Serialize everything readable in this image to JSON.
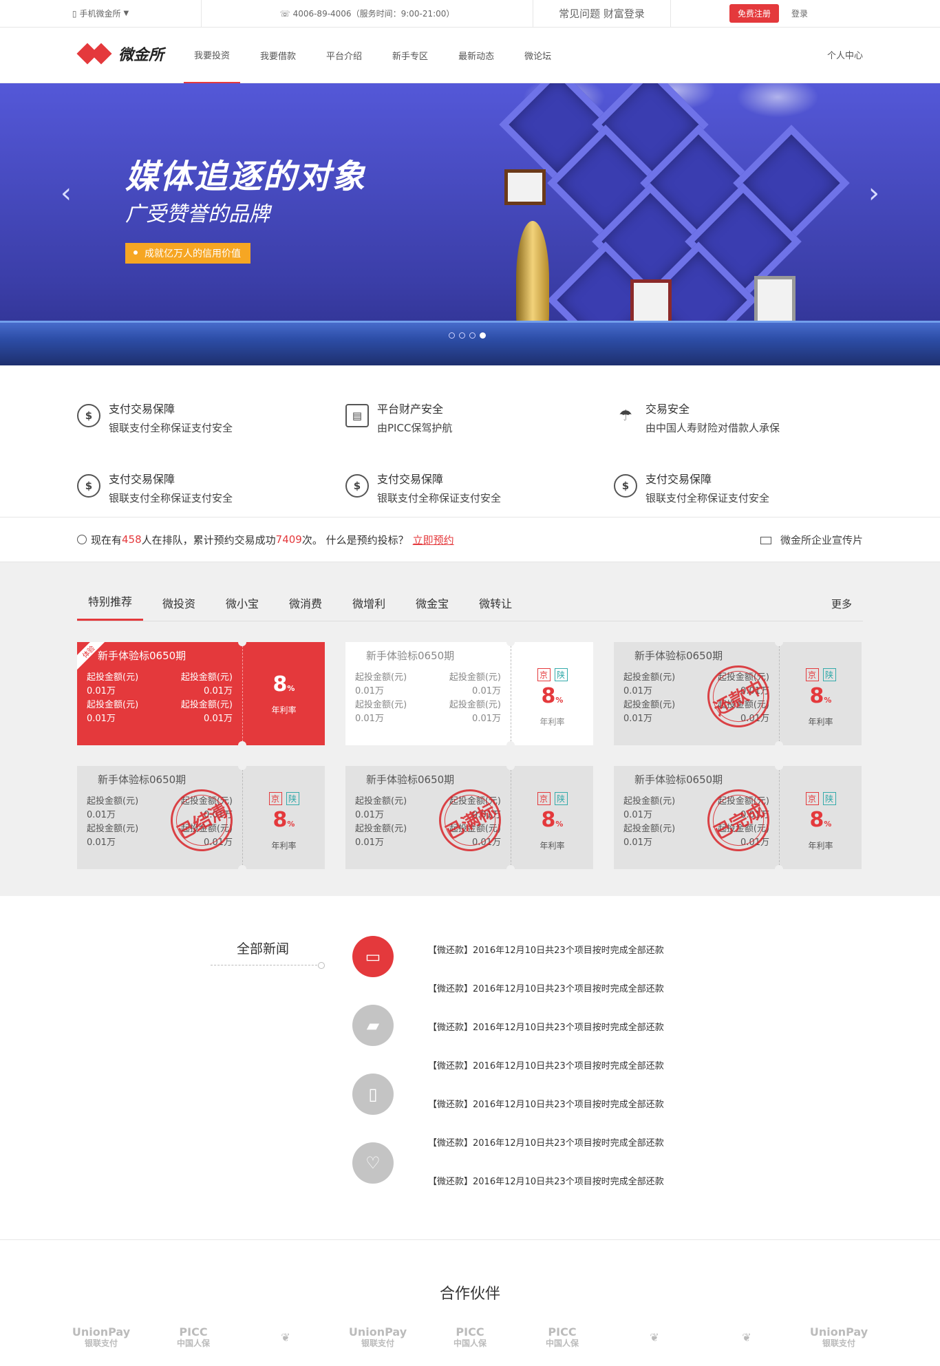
{
  "topbar": {
    "mobile": "手机微金所",
    "phone": "4006-89-4006（服务时间：9:00-21:00）",
    "faq": "常见问题 财富登录",
    "register": "免费注册",
    "login": "登录"
  },
  "nav": {
    "logo": "微金所",
    "items": [
      "我要投资",
      "我要借款",
      "平台介绍",
      "新手专区",
      "最新动态",
      "微论坛"
    ],
    "personal": "个人中心"
  },
  "banner": {
    "title": "媒体追逐的对象",
    "subtitle": "广受赞誉的品牌",
    "button": "成就亿万人的信用价值",
    "dots": 4,
    "active_dot": 4
  },
  "features": [
    {
      "icon": "dollar-shield-icon",
      "title": "支付交易保障",
      "desc": "银联支付全称保证支付安全"
    },
    {
      "icon": "register-icon",
      "title": "平台财产安全",
      "desc": "由PICC保驾护航"
    },
    {
      "icon": "umbrella-icon",
      "title": "交易安全",
      "desc": "由中国人寿财险对借款人承保"
    },
    {
      "icon": "dollar-shield-icon",
      "title": "支付交易保障",
      "desc": "银联支付全称保证支付安全"
    },
    {
      "icon": "dollar-shield-icon",
      "title": "支付交易保障",
      "desc": "银联支付全称保证支付安全"
    },
    {
      "icon": "dollar-shield-icon",
      "title": "支付交易保障",
      "desc": "银联支付全称保证支付安全"
    }
  ],
  "strip": {
    "t1": "现在有",
    "queue": "458",
    "t2": "人在排队，累计预约交易成功",
    "count": "7409",
    "t3": "次。 什么是预约投标？",
    "link": "立即预约",
    "video": "微金所企业宣传片"
  },
  "products": {
    "tabs": [
      "特别推荐",
      "微投资",
      "微小宝",
      "微消费",
      "微增利",
      "微金宝",
      "微转让"
    ],
    "more": "更多",
    "cards": [
      {
        "style": "red",
        "corner": "体验",
        "title": "新手体验标0650期",
        "k1": "起投金额(元)",
        "v1": "0.01万",
        "k2": "起投金额(元)",
        "v2": "0.01万",
        "rate": "8",
        "rate_unit": "%",
        "rate_label": "年利率",
        "badges": [],
        "stamp": ""
      },
      {
        "style": "white",
        "corner": "",
        "title": "新手体验标0650期",
        "k1": "起投金额(元)",
        "v1": "0.01万",
        "k2": "起投金额(元)",
        "v2": "0.01万",
        "rate": "8",
        "rate_unit": "%",
        "rate_label": "年利率",
        "badges": [
          "京",
          "陕"
        ],
        "stamp": ""
      },
      {
        "style": "grey",
        "corner": "",
        "title": "新手体验标0650期",
        "k1": "起投金额(元)",
        "v1": "0.01万",
        "k2": "起投金额(元)",
        "v2": "0.01万",
        "rate": "8",
        "rate_unit": "%",
        "rate_label": "年利率",
        "badges": [
          "京",
          "陕"
        ],
        "stamp": "还款中"
      },
      {
        "style": "grey",
        "corner": "",
        "title": "新手体验标0650期",
        "k1": "起投金额(元)",
        "v1": "0.01万",
        "k2": "起投金额(元)",
        "v2": "0.01万",
        "rate": "8",
        "rate_unit": "%",
        "rate_label": "年利率",
        "badges": [
          "京",
          "陕"
        ],
        "stamp": "已结清"
      },
      {
        "style": "grey",
        "corner": "",
        "title": "新手体验标0650期",
        "k1": "起投金额(元)",
        "v1": "0.01万",
        "k2": "起投金额(元)",
        "v2": "0.01万",
        "rate": "8",
        "rate_unit": "%",
        "rate_label": "年利率",
        "badges": [
          "京",
          "陕"
        ],
        "stamp": "已满标"
      },
      {
        "style": "grey",
        "corner": "",
        "title": "新手体验标0650期",
        "k1": "起投金额(元)",
        "v1": "0.01万",
        "k2": "起投金额(元)",
        "v2": "0.01万",
        "rate": "8",
        "rate_unit": "%",
        "rate_label": "年利率",
        "badges": [
          "京",
          "陕"
        ],
        "stamp": "已完成"
      }
    ]
  },
  "news": {
    "heading": "全部新闻",
    "icons": [
      "inbox-icon",
      "folder-icon",
      "phone-icon",
      "heart-icon"
    ],
    "items": [
      "【微还款】2016年12月10日共23个项目按时完成全部还款",
      "【微还款】2016年12月10日共23个项目按时完成全部还款",
      "【微还款】2016年12月10日共23个项目按时完成全部还款",
      "【微还款】2016年12月10日共23个项目按时完成全部还款",
      "【微还款】2016年12月10日共23个项目按时完成全部还款",
      "【微还款】2016年12月10日共23个项目按时完成全部还款",
      "【微还款】2016年12月10日共23个项目按时完成全部还款"
    ]
  },
  "partners": {
    "title": "合作伙伴",
    "logos": [
      {
        "name": "unionpay-logo",
        "line1": "UnionPay",
        "line2": "银联支付"
      },
      {
        "name": "picc-logo",
        "line1": "PICC",
        "line2": "中国人保"
      },
      {
        "name": "plant-logo",
        "line1": "❦",
        "line2": ""
      },
      {
        "name": "unionpay-logo",
        "line1": "UnionPay",
        "line2": "银联支付"
      },
      {
        "name": "picc-logo",
        "line1": "PICC",
        "line2": "中国人保"
      },
      {
        "name": "picc-logo",
        "line1": "PICC",
        "line2": "中国人保"
      },
      {
        "name": "plant-logo",
        "line1": "❦",
        "line2": ""
      },
      {
        "name": "plant-logo",
        "line1": "❦",
        "line2": ""
      },
      {
        "name": "unionpay-logo",
        "line1": "UnionPay",
        "line2": "银联支付"
      }
    ]
  },
  "colors": {
    "accent": "#e4393c",
    "banner": "#4d50cc",
    "orange": "#f6a623"
  }
}
